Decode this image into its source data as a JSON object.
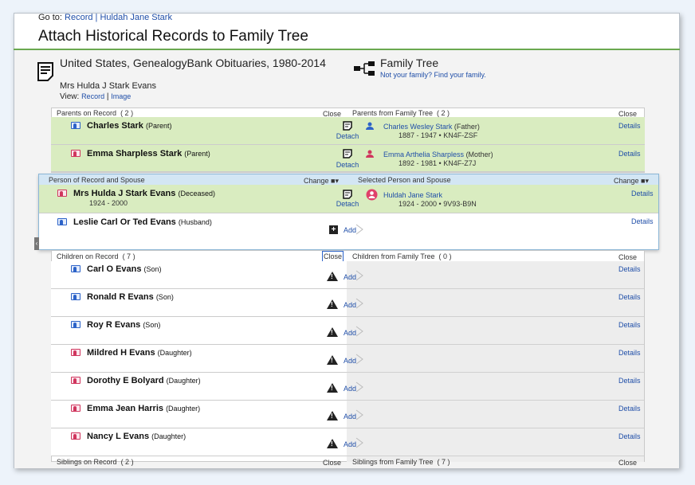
{
  "goto": {
    "label": "Go to:",
    "record_link": "Record | Huldah Jane Stark"
  },
  "title": "Attach Historical Records to Family Tree",
  "record": {
    "title": "United States, GenealogyBank Obituaries, 1980-2014",
    "subject": "Mrs Hulda J Stark Evans",
    "view_label": "View:",
    "view_record": "Record",
    "view_image": "Image"
  },
  "tree": {
    "title": "Family Tree",
    "sub": "Not your family? Find your family."
  },
  "parents": {
    "left_header": "Parents on Record",
    "left_count": "( 2 )",
    "close": "Close",
    "right_header": "Parents from Family Tree",
    "right_count": "( 2 )",
    "rows": [
      {
        "name": "Charles Stark",
        "role": "(Parent)",
        "detach": "Detach",
        "ft_name": "Charles Wesley Stark",
        "ft_rel": "(Father)",
        "ft_dates": "1887 - 1947 • KN4F-ZSF",
        "details": "Details"
      },
      {
        "name": "Emma Sharpless Stark",
        "role": "(Parent)",
        "detach": "Detach",
        "ft_name": "Emma Arthelia Sharpless",
        "ft_rel": "(Mother)",
        "ft_dates": "1892 - 1981 • KN4F-Z7J",
        "details": "Details"
      }
    ]
  },
  "spouse": {
    "left_header": "Person of Record and Spouse",
    "change": "Change",
    "right_header": "Selected Person and Spouse",
    "person": {
      "name": "Mrs Hulda J Stark Evans",
      "role": "(Deceased)",
      "dates": "1924 - 2000",
      "detach": "Detach",
      "ft_name": "Huldah Jane Stark",
      "ft_dates": "1924 - 2000 • 9V93-B9N",
      "details": "Details"
    },
    "spouse_row": {
      "name": "Leslie Carl Or Ted Evans",
      "role": "(Husband)",
      "add": "Add",
      "details": "Details"
    }
  },
  "children": {
    "left_header": "Children on Record",
    "left_count": "( 7 )",
    "close": "Close",
    "right_header": "Children from Family Tree",
    "right_count": "( 0 )",
    "rows": [
      {
        "name": "Carl O Evans",
        "role": "(Son)",
        "g": "m"
      },
      {
        "name": "Ronald R Evans",
        "role": "(Son)",
        "g": "m"
      },
      {
        "name": "Roy R Evans",
        "role": "(Son)",
        "g": "m"
      },
      {
        "name": "Mildred H Evans",
        "role": "(Daughter)",
        "g": "f"
      },
      {
        "name": "Dorothy E Bolyard",
        "role": "(Daughter)",
        "g": "f"
      },
      {
        "name": "Emma Jean Harris",
        "role": "(Daughter)",
        "g": "f"
      },
      {
        "name": "Nancy L Evans",
        "role": "(Daughter)",
        "g": "f"
      }
    ],
    "add": "Add",
    "details": "Details"
  },
  "siblings": {
    "left_header": "Siblings on Record",
    "left_count": "( 2 )",
    "close": "Close",
    "right_header": "Siblings from Family Tree",
    "right_count": "( 7 )"
  }
}
